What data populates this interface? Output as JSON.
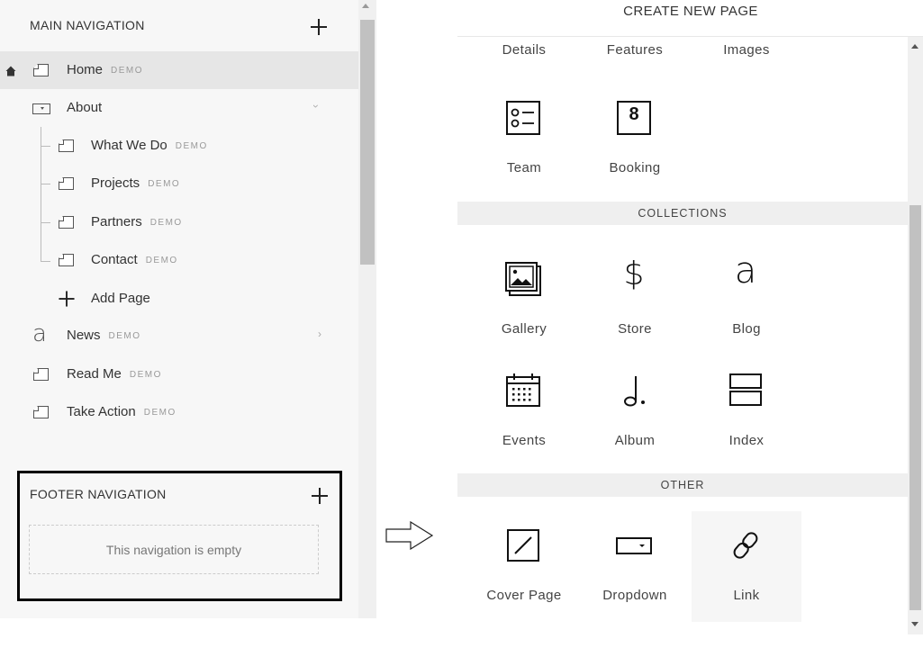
{
  "sidebar": {
    "main_nav_title": "MAIN NAVIGATION",
    "items": [
      {
        "label": "Home",
        "badge": "DEMO"
      },
      {
        "label": "About",
        "badge": ""
      },
      {
        "label": "What We Do",
        "badge": "DEMO"
      },
      {
        "label": "Projects",
        "badge": "DEMO"
      },
      {
        "label": "Partners",
        "badge": "DEMO"
      },
      {
        "label": "Contact",
        "badge": "DEMO"
      },
      {
        "label": "Add Page",
        "badge": ""
      },
      {
        "label": "News",
        "badge": "DEMO"
      },
      {
        "label": "Read Me",
        "badge": "DEMO"
      },
      {
        "label": "Take Action",
        "badge": "DEMO"
      }
    ],
    "footer_nav_title": "FOOTER NAVIGATION",
    "footer_empty_text": "This navigation is empty"
  },
  "panel": {
    "title": "CREATE NEW PAGE",
    "top_labels": [
      "Details",
      "Features",
      "Images"
    ],
    "layouts": [
      {
        "label": "Team",
        "icon": "team-icon"
      },
      {
        "label": "Booking",
        "icon": "booking-icon",
        "glyph": "8"
      }
    ],
    "collections_title": "COLLECTIONS",
    "collections": [
      {
        "label": "Gallery",
        "icon": "gallery-icon"
      },
      {
        "label": "Store",
        "icon": "store-icon",
        "glyph": "$"
      },
      {
        "label": "Blog",
        "icon": "blog-icon",
        "glyph": "a"
      },
      {
        "label": "Events",
        "icon": "events-icon"
      },
      {
        "label": "Album",
        "icon": "album-icon"
      },
      {
        "label": "Index",
        "icon": "index-icon"
      }
    ],
    "other_title": "OTHER",
    "other": [
      {
        "label": "Cover Page",
        "icon": "cover-page-icon"
      },
      {
        "label": "Dropdown",
        "icon": "dropdown-icon"
      },
      {
        "label": "Link",
        "icon": "link-icon"
      }
    ]
  }
}
